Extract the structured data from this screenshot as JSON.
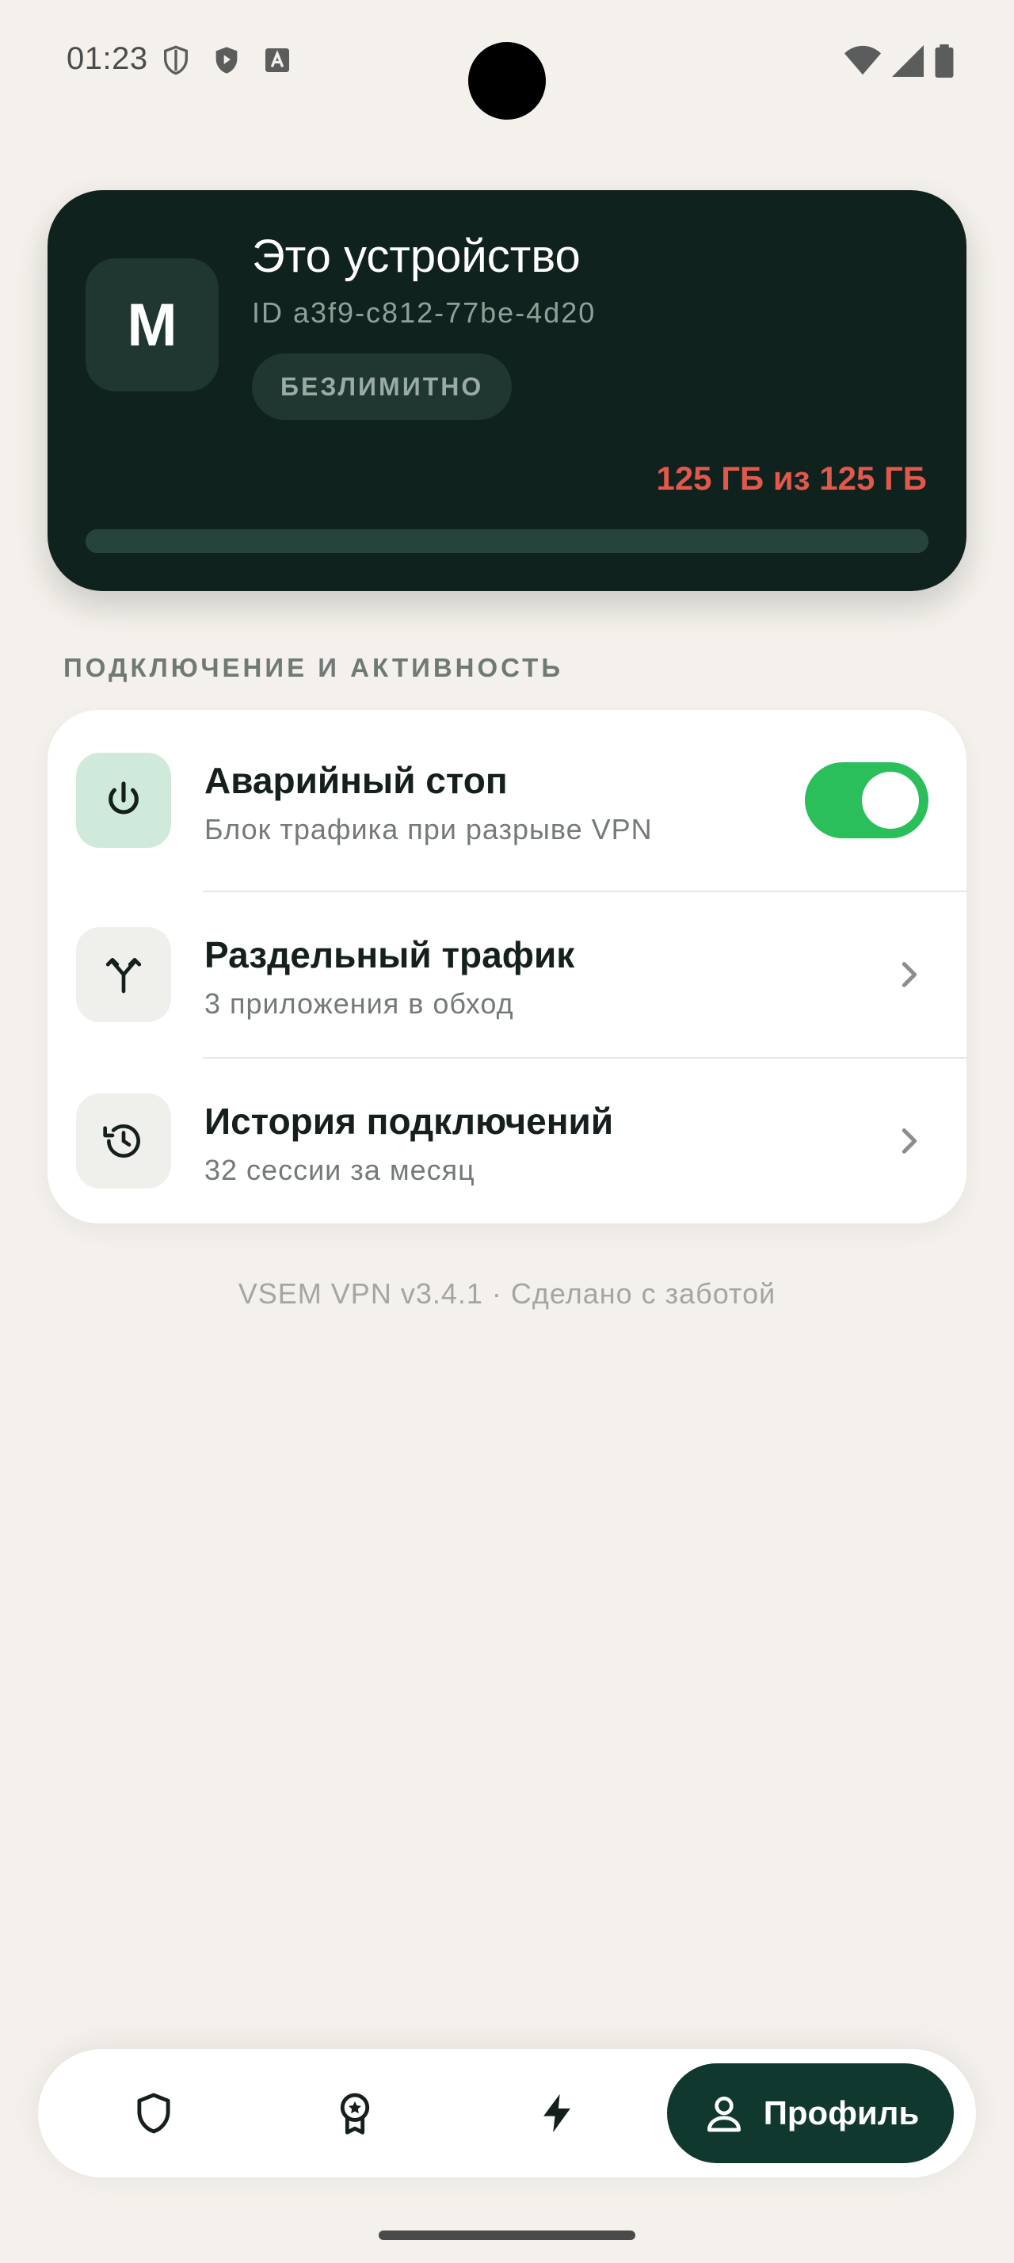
{
  "status_bar": {
    "time": "01:23",
    "left_icons": [
      "shield-outline-icon",
      "shield-play-icon",
      "font-a-icon"
    ],
    "right_icons": [
      "wifi-icon",
      "signal-icon",
      "battery-icon"
    ]
  },
  "device_card": {
    "avatar_letter": "M",
    "title": "Это устройство",
    "device_id": "ID a3f9-c812-77be-4d20",
    "plan_badge": "БЕЗЛИМИТНО",
    "usage_text": "125 ГБ из 125 ГБ",
    "usage_fraction": 1.0,
    "colors": {
      "background": "#10221e",
      "usage_text": "#e2584a"
    }
  },
  "section": {
    "heading": "ПОДКЛЮЧЕНИЕ И АКТИВНОСТЬ",
    "items": [
      {
        "icon": "power-icon",
        "title": "Аварийный стоп",
        "subtitle": "Блок трафика при разрыве VPN",
        "control": "toggle",
        "toggle_on": true
      },
      {
        "icon": "split-arrows-icon",
        "title": "Раздельный трафик",
        "subtitle": "3 приложения в обход",
        "control": "chevron"
      },
      {
        "icon": "history-icon",
        "title": "История подключений",
        "subtitle": "32 сессии за месяц",
        "control": "chevron"
      }
    ]
  },
  "footer_note": "VSEM VPN v3.4.1 · Сделано с заботой",
  "bottom_nav": {
    "items": [
      {
        "icon": "shield-icon",
        "label": ""
      },
      {
        "icon": "award-icon",
        "label": ""
      },
      {
        "icon": "bolt-icon",
        "label": ""
      },
      {
        "icon": "user-icon",
        "label": "Профиль",
        "active": true
      }
    ],
    "accent": "#10382e"
  },
  "colors": {
    "background": "#f4f0eb",
    "toggle_on": "#2bbf5c"
  }
}
